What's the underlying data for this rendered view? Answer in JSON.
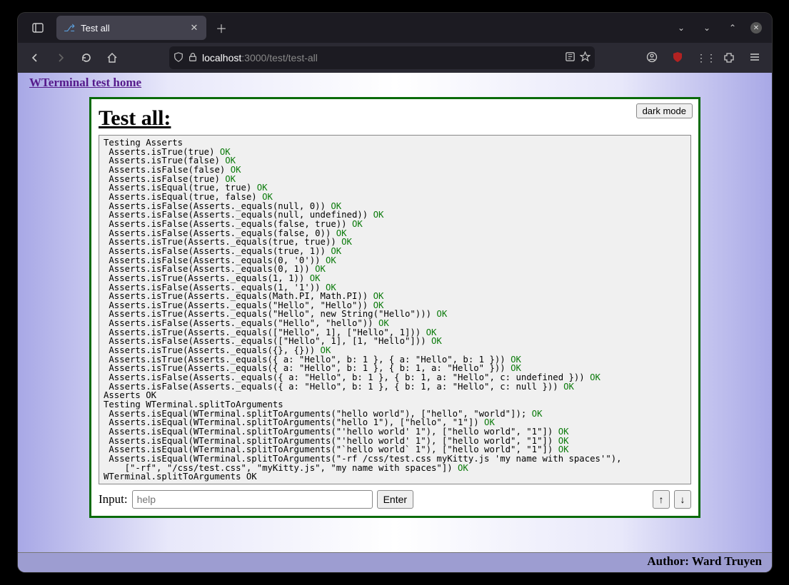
{
  "browser": {
    "tab_title": "Test all",
    "url_dim1": "localhost",
    "url_dim2": ":3000/test/test-all"
  },
  "page": {
    "home_link": "WTerminal test home",
    "heading": "Test all:",
    "dark_mode": "dark mode",
    "input_label": "Input:",
    "input_placeholder": "help",
    "enter": "Enter",
    "up": "↑",
    "down": "↓",
    "author": "Author: Ward Truyen"
  },
  "log": [
    {
      "t": "Testing Asserts",
      "ok": ""
    },
    {
      "t": " Asserts.isTrue(true) ",
      "ok": "OK"
    },
    {
      "t": " Asserts.isTrue(false) ",
      "ok": "OK"
    },
    {
      "t": " Asserts.isFalse(false) ",
      "ok": "OK"
    },
    {
      "t": " Asserts.isFalse(true) ",
      "ok": "OK"
    },
    {
      "t": " Asserts.isEqual(true, true) ",
      "ok": "OK"
    },
    {
      "t": " Asserts.isEqual(true, false) ",
      "ok": "OK"
    },
    {
      "t": " Asserts.isFalse(Asserts._equals(null, 0)) ",
      "ok": "OK"
    },
    {
      "t": " Asserts.isFalse(Asserts._equals(null, undefined)) ",
      "ok": "OK"
    },
    {
      "t": " Asserts.isFalse(Asserts._equals(false, true)) ",
      "ok": "OK"
    },
    {
      "t": " Asserts.isFalse(Asserts._equals(false, 0)) ",
      "ok": "OK"
    },
    {
      "t": " Asserts.isTrue(Asserts._equals(true, true)) ",
      "ok": "OK"
    },
    {
      "t": " Asserts.isFalse(Asserts._equals(true, 1)) ",
      "ok": "OK"
    },
    {
      "t": " Asserts.isFalse(Asserts._equals(0, '0')) ",
      "ok": "OK"
    },
    {
      "t": " Asserts.isFalse(Asserts._equals(0, 1)) ",
      "ok": "OK"
    },
    {
      "t": " Asserts.isTrue(Asserts._equals(1, 1)) ",
      "ok": "OK"
    },
    {
      "t": " Asserts.isFalse(Asserts._equals(1, '1')) ",
      "ok": "OK"
    },
    {
      "t": " Asserts.isTrue(Asserts._equals(Math.PI, Math.PI)) ",
      "ok": "OK"
    },
    {
      "t": " Asserts.isTrue(Asserts._equals(\"Hello\", \"Hello\")) ",
      "ok": "OK"
    },
    {
      "t": " Asserts.isTrue(Asserts._equals(\"Hello\", new String(\"Hello\"))) ",
      "ok": "OK"
    },
    {
      "t": " Asserts.isFalse(Asserts._equals(\"Hello\", \"hello\")) ",
      "ok": "OK"
    },
    {
      "t": " Asserts.isTrue(Asserts._equals([\"Hello\", 1], [\"Hello\", 1])) ",
      "ok": "OK"
    },
    {
      "t": " Asserts.isFalse(Asserts._equals([\"Hello\", 1], [1, \"Hello\"])) ",
      "ok": "OK"
    },
    {
      "t": " Asserts.isTrue(Asserts._equals({}, {})) ",
      "ok": "OK"
    },
    {
      "t": " Asserts.isTrue(Asserts._equals({ a: \"Hello\", b: 1 }, { a: \"Hello\", b: 1 })) ",
      "ok": "OK"
    },
    {
      "t": " Asserts.isTrue(Asserts._equals({ a: \"Hello\", b: 1 }, { b: 1, a: \"Hello\" })) ",
      "ok": "OK"
    },
    {
      "t": " Asserts.isFalse(Asserts._equals({ a: \"Hello\", b: 1 }, { b: 1, a: \"Hello\", c: undefined })) ",
      "ok": "OK"
    },
    {
      "t": " Asserts.isFalse(Asserts._equals({ a: \"Hello\", b: 1 }, { b: 1, a: \"Hello\", c: null })) ",
      "ok": "OK"
    },
    {
      "t": "Asserts OK",
      "ok": ""
    },
    {
      "t": "Testing WTerminal.splitToArguments",
      "ok": ""
    },
    {
      "t": " Asserts.isEqual(WTerminal.splitToArguments(\"hello world\"), [\"hello\", \"world\"]); ",
      "ok": "OK"
    },
    {
      "t": " Asserts.isEqual(WTerminal.splitToArguments(\"hello 1\"), [\"hello\", \"1\"]) ",
      "ok": "OK"
    },
    {
      "t": " Asserts.isEqual(WTerminal.splitToArguments(\"'hello world' 1\"), [\"hello world\", \"1\"]) ",
      "ok": "OK"
    },
    {
      "t": " Asserts.isEqual(WTerminal.splitToArguments(\"'hello world' 1\"), [\"hello world\", \"1\"]) ",
      "ok": "OK"
    },
    {
      "t": " Asserts.isEqual(WTerminal.splitToArguments(\"`hello world` 1\"), [\"hello world\", \"1\"]) ",
      "ok": "OK"
    },
    {
      "t": " Asserts.isEqual(WTerminal.splitToArguments(\"-rf /css/test.css myKitty.js 'my name with spaces'\"),\n    [\"-rf\", \"/css/test.css\", \"myKitty.js\", \"my name with spaces\"]) ",
      "ok": "OK"
    },
    {
      "t": "WTerminal.splitToArguments OK",
      "ok": ""
    }
  ]
}
